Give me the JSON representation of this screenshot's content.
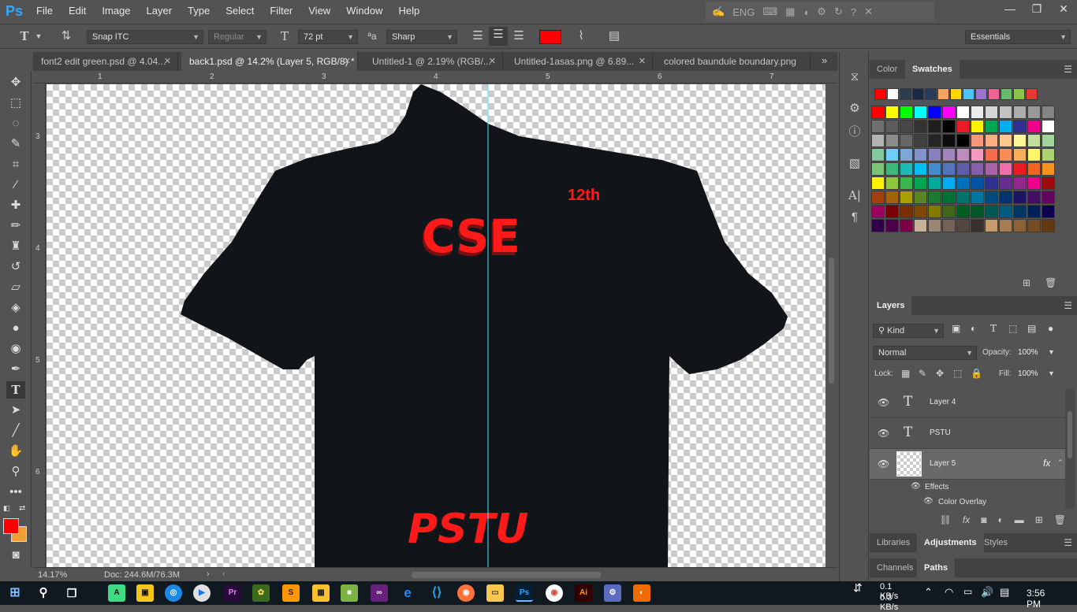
{
  "app": {
    "logo": "Ps"
  },
  "menu": [
    "File",
    "Edit",
    "Image",
    "Layer",
    "Type",
    "Select",
    "Filter",
    "View",
    "Window",
    "Help"
  ],
  "system_bar": {
    "language": "ENG"
  },
  "options": {
    "font_family": "Snap ITC",
    "font_style": "Regular",
    "font_size": "72 pt",
    "antialias": "Sharp",
    "text_color": "#ff0000",
    "workspace": "Essentials"
  },
  "tabs": [
    {
      "label": "font2 edit green.psd @ 4.04..."
    },
    {
      "label": "back1.psd @ 14.2% (Layer 5, RGB/8) *"
    },
    {
      "label": "Untitled-1 @ 2.19% (RGB/..."
    },
    {
      "label": "Untitled-1asas.png @ 6.89..."
    },
    {
      "label": "colored baundule  boundary.png"
    }
  ],
  "rulers": {
    "top": [
      "1",
      "2",
      "3",
      "4",
      "5",
      "6",
      "7"
    ],
    "left": [
      "3",
      "4",
      "5",
      "6"
    ]
  },
  "canvas": {
    "text_12th": "12th",
    "text_cse": "CSE",
    "text_pstu": "PSTU",
    "shirt_color": "#111418",
    "text_color": "#ff1a1a",
    "guide_color": "#4fe3ff"
  },
  "status": {
    "zoom": "14.17%",
    "doc": "Doc: 244.6M/76.3M"
  },
  "swatches_panel": {
    "tabs": [
      "Color",
      "Swatches"
    ],
    "recent": [
      "#ff0000",
      "#ffffff",
      "#2a3d52",
      "#1a2a44",
      "#283b5a",
      "#f4a460",
      "#ffd700",
      "#4fc3f7",
      "#9575cd",
      "#f06292",
      "#66bb6a",
      "#8bc34a",
      "#e53935"
    ],
    "grid": [
      "#ff0000",
      "#ffff00",
      "#00ff00",
      "#00ffff",
      "#0000ff",
      "#ff00ff",
      "#ffffff",
      "#ebebeb",
      "#d6d6d6",
      "#c2c2c2",
      "#adadad",
      "#999999",
      "#858585",
      "#707070",
      "#5c5c5c",
      "#474747",
      "#333333",
      "#1f1f1f",
      "#000000",
      "#ed1c24",
      "#fff200",
      "#00a651",
      "#00aeef",
      "#2e3192",
      "#ec008c",
      "#ffffff",
      "#b3b3b3",
      "#8c8c8c",
      "#666666",
      "#404040",
      "#262626",
      "#0d0d0d",
      "#000000",
      "#f7977a",
      "#f9ad81",
      "#fdc68a",
      "#fff79a",
      "#c4df9b",
      "#a3d39c",
      "#82ca9d",
      "#6dcff6",
      "#7da7d9",
      "#8393ca",
      "#8781bd",
      "#a186be",
      "#bd8cbf",
      "#f49ac2",
      "#f26c4f",
      "#f68e56",
      "#fbaf5d",
      "#fff568",
      "#acd372",
      "#7cc576",
      "#3bb878",
      "#1abbb4",
      "#00bff3",
      "#448ccb",
      "#5574b9",
      "#605ca8",
      "#855fa8",
      "#a763a8",
      "#f06ea9",
      "#ed1c24",
      "#f26522",
      "#f7941d",
      "#fff200",
      "#8dc73f",
      "#39b54a",
      "#00a651",
      "#00a99d",
      "#00aeef",
      "#0072bc",
      "#0054a6",
      "#2e3192",
      "#662d91",
      "#92278f",
      "#ec008c",
      "#9e0b0f",
      "#a0410d",
      "#a3620a",
      "#aba000",
      "#598527",
      "#1a7b30",
      "#007236",
      "#00746b",
      "#0076a3",
      "#004b80",
      "#003471",
      "#1b1464",
      "#440e62",
      "#630460",
      "#9e005d",
      "#790000",
      "#7b2e00",
      "#7d4900",
      "#827b00",
      "#406618",
      "#005e20",
      "#005826",
      "#005952",
      "#005b7f",
      "#003663",
      "#002157",
      "#0d004c",
      "#32004b",
      "#4b0049",
      "#7b0046",
      "#c7b299",
      "#998675",
      "#736357",
      "#534741",
      "#37302d",
      "#c69c6d",
      "#a67c52",
      "#8c6239",
      "#754c24",
      "#603913"
    ]
  },
  "layers_panel": {
    "title": "Layers",
    "filter": "Kind",
    "blend_mode": "Normal",
    "opacity_label": "Opacity:",
    "opacity": "100%",
    "lock_label": "Lock:",
    "fill_label": "Fill:",
    "fill": "100%",
    "layers": [
      {
        "name": "Layer 4",
        "kind": "text"
      },
      {
        "name": "PSTU",
        "kind": "text"
      },
      {
        "name": "Layer 5",
        "kind": "pixel",
        "selected": true
      }
    ],
    "effects_label": "Effects",
    "effect": "Color Overlay"
  },
  "bottom_tabs_1": [
    "Libraries",
    "Adjustments",
    "Styles"
  ],
  "bottom_tabs_2": [
    "Channels",
    "Paths"
  ],
  "taskbar": {
    "net_up": "0.1 KB/s",
    "net_down": "0.3 KB/s",
    "time": "3:56 PM"
  }
}
